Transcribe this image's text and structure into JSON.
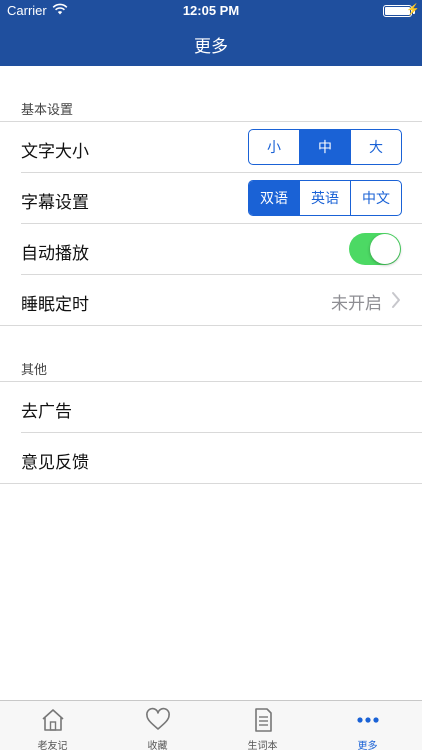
{
  "status_bar": {
    "carrier": "Carrier",
    "time": "12:05 PM"
  },
  "nav": {
    "title": "更多"
  },
  "sections": {
    "basic": {
      "header": "基本设置",
      "font_size": {
        "label": "文字大小",
        "options": [
          "小",
          "中",
          "大"
        ],
        "selected": "中"
      },
      "subtitle": {
        "label": "字幕设置",
        "options": [
          "双语",
          "英语",
          "中文"
        ],
        "selected": "双语"
      },
      "autoplay": {
        "label": "自动播放",
        "enabled": true
      },
      "sleep_timer": {
        "label": "睡眠定时",
        "value": "未开启"
      }
    },
    "other": {
      "header": "其他",
      "remove_ads": {
        "label": "去广告"
      },
      "feedback": {
        "label": "意见反馈"
      }
    }
  },
  "tabs": [
    {
      "label": "老友记",
      "icon": "home-icon"
    },
    {
      "label": "收藏",
      "icon": "heart-icon"
    },
    {
      "label": "生词本",
      "icon": "notebook-icon"
    },
    {
      "label": "更多",
      "icon": "more-icon",
      "active": true
    }
  ],
  "colors": {
    "nav_bg": "#1f4f9e",
    "accent": "#1a62d6",
    "toggle_on": "#4cd964"
  }
}
